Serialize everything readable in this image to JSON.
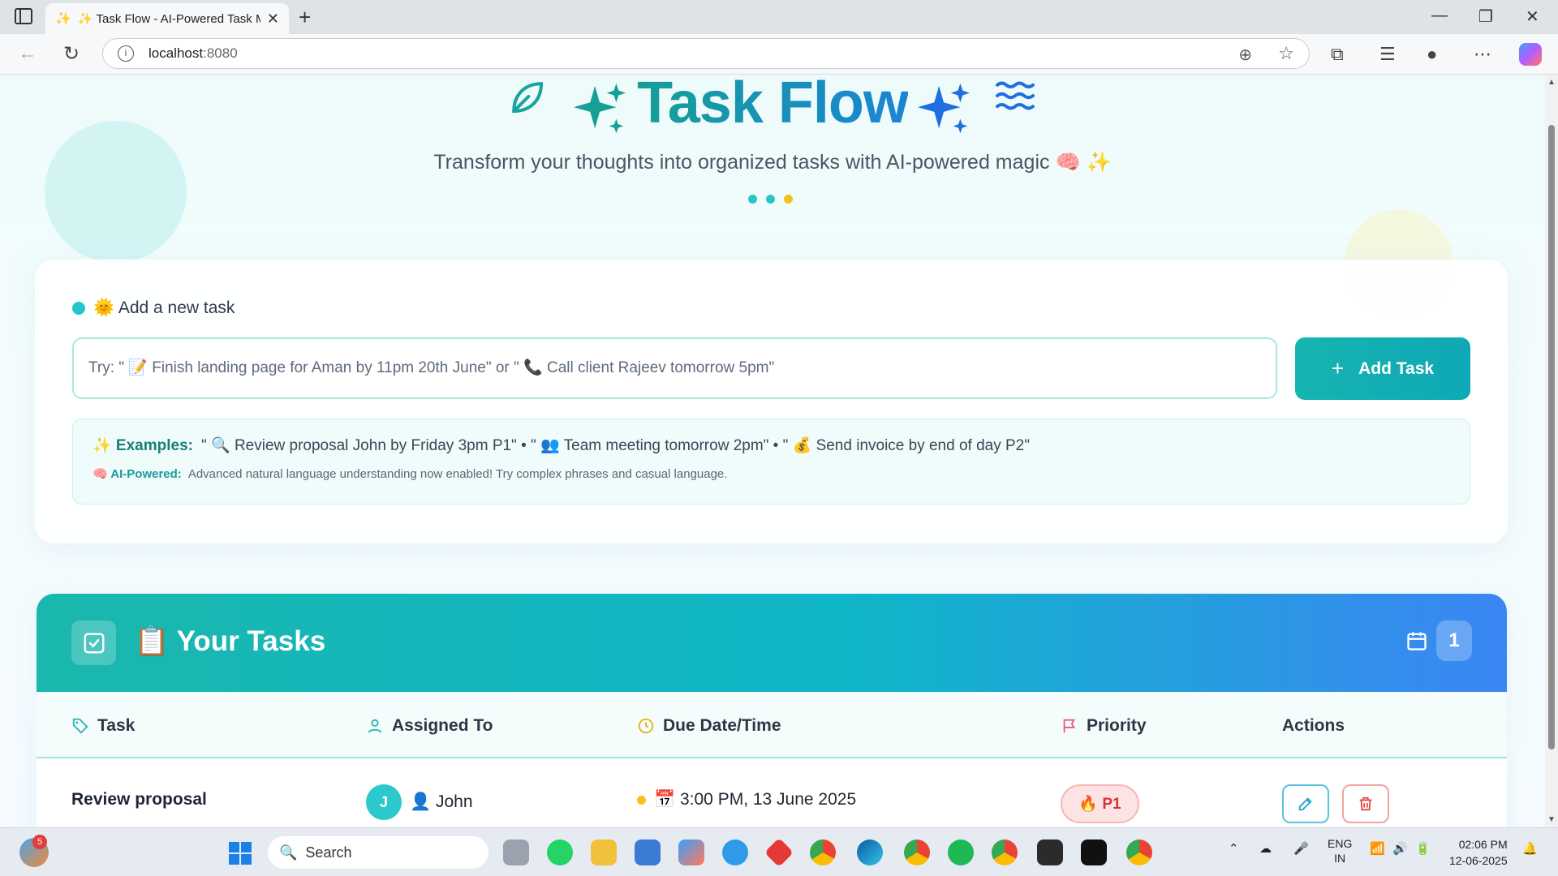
{
  "browser": {
    "tab_title": "✨ Task Flow - AI-Powered Task M",
    "tab_favicon": "✨",
    "url_host": "localhost",
    "url_port": ":8080"
  },
  "hero": {
    "title": "Task Flow",
    "subtitle": "Transform your thoughts into organized tasks with AI-powered magic 🧠 ✨",
    "dot_colors": [
      "#25c6c9",
      "#25c6c9",
      "#f2c21b"
    ]
  },
  "add_task": {
    "label": "🌞 Add a new task",
    "placeholder": "Try: \" 📝 Finish landing page for Aman by 11pm 20th June\" or \" 📞 Call client Rajeev tomorrow 5pm\"",
    "button_label": "Add Task",
    "examples_head": "✨ Examples:",
    "examples_text": "\" 🔍 Review proposal John by Friday 3pm P1\" • \" 👥 Team meeting tomorrow 2pm\" • \" 💰 Send invoice by end of day P2\"",
    "ai_head": "🧠 AI-Powered:",
    "ai_text": "Advanced natural language understanding now enabled! Try complex phrases and casual language."
  },
  "tasks": {
    "title": "📋 Your Tasks",
    "count": "1",
    "columns": {
      "task": "Task",
      "assigned": "Assigned To",
      "due": "Due Date/Time",
      "priority": "Priority",
      "actions": "Actions"
    },
    "rows": [
      {
        "task": "Review proposal",
        "avatar_initial": "J",
        "assignee": "👤 John",
        "due": "📅 3:00 PM, 13 June 2025",
        "priority": "🔥 P1"
      }
    ]
  },
  "taskbar": {
    "weather_badge": "5",
    "search_label": "Search",
    "lang_line1": "ENG",
    "lang_line2": "IN",
    "time": "02:06 PM",
    "date": "12-06-2025"
  },
  "colors": {
    "accent": "#1aa39b",
    "header_gradient_start": "#1ab7ad",
    "header_gradient_end": "#3b86f4",
    "priority_red": "#d13535"
  }
}
